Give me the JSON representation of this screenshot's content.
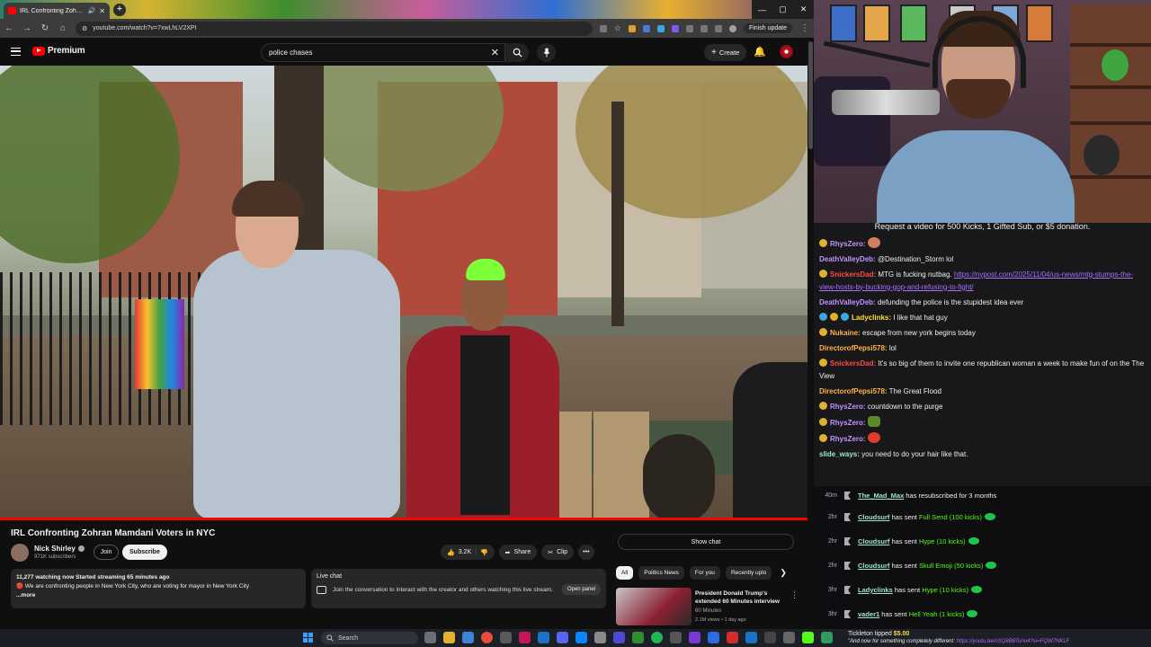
{
  "browser": {
    "tab_title": "IRL Confronting Zohran Ma",
    "url": "youtube.com/watch?v=7xwLhLV2XPI",
    "finish_update": "Finish update"
  },
  "youtube": {
    "logo": "Premium",
    "search_query": "police chases",
    "create_label": "Create",
    "video_title": "IRL Confronting Zohran Mamdani Voters in NYC",
    "channel_name": "Nick Shirley",
    "subscribers": "971K subscribers",
    "join_label": "Join",
    "subscribe_label": "Subscribe",
    "likes": "3.2K",
    "share_label": "Share",
    "clip_label": "Clip",
    "show_chat": "Show chat",
    "description": {
      "stats": "11,277 watching now  Started streaming 65 minutes ago",
      "text": "🔴 We are confronting people in New York City, who are voting for mayor in New York City",
      "more": "...more"
    },
    "live_chat": {
      "title": "Live chat",
      "text": "Join the conversation to interact with the creator and others watching this live stream.",
      "open_panel": "Open panel"
    },
    "chips": [
      "All",
      "Politics News",
      "For you",
      "Recently uplo"
    ],
    "recommendation": {
      "title": "President Donald Trump's extended 60 Minutes interview",
      "channel": "60 Minutes",
      "meta": "2.1M views • 1 day ago"
    }
  },
  "chat": {
    "goal_text": "Request a video for 500 Kicks, 1 Gifted Sub, or $5 donation.",
    "messages": [
      {
        "user": "RhysZero:",
        "color": "#bf94ff",
        "text": ""
      },
      {
        "user": "DeathValleyDeb:",
        "color": "#bf94ff",
        "text": "@Destination_Storm lol"
      },
      {
        "user": "SnickersDad:",
        "color": "#ff4a4a",
        "text": "MTG is fucking nutbag.",
        "link": "https://nypost.com/2025/11/04/us-news/mtg-stumps-the-view-hosts-by-bucking-gop-and-refusing-to-fight/"
      },
      {
        "user": "DeathValleyDeb:",
        "color": "#bf94ff",
        "text": "defunding the police is the stupidest idea ever"
      },
      {
        "user": "Ladyclinks:",
        "color": "#ffde3a",
        "text": "I like that hat guy"
      },
      {
        "user": "Nukaine:",
        "color": "#ffb347",
        "text": "escape from new york begins today"
      },
      {
        "user": "DirectorofPepsi578:",
        "color": "#ffb347",
        "text": "lol"
      },
      {
        "user": "SnickersDad:",
        "color": "#ff4a4a",
        "text": "It's so big of them to invite one republican woman a week to make fun of on the The View"
      },
      {
        "user": "DirectorofPepsi578:",
        "color": "#ffb347",
        "text": "The Great Flood"
      },
      {
        "user": "RhysZero:",
        "color": "#bf94ff",
        "text": "countdown to the purge"
      },
      {
        "user": "RhysZero:",
        "color": "#bf94ff",
        "text": ""
      },
      {
        "user": "RhysZero:",
        "color": "#bf94ff",
        "text": ""
      },
      {
        "user": "slide_ways:",
        "color": "#a0e4c7",
        "text": "you need to do your hair like that."
      }
    ],
    "events": [
      {
        "time": "40m",
        "user": "The_Mad_Max",
        "text": "has resubscribed for 3 months",
        "gift": ""
      },
      {
        "time": "2hr",
        "user": "Cloudsurf",
        "text": "has sent",
        "gift": "Full Send (100 kicks)"
      },
      {
        "time": "2hr",
        "user": "Cloudsurf",
        "text": "has sent",
        "gift": "Hype (10 kicks)"
      },
      {
        "time": "2hr",
        "user": "Cloudsurf",
        "text": "has sent",
        "gift": "Skull Emoji (50 kicks)"
      },
      {
        "time": "3hr",
        "user": "Ladyclinks",
        "text": "has sent",
        "gift": "Hype (10 kicks)"
      },
      {
        "time": "3hr",
        "user": "vader1",
        "text": "has sent",
        "gift": "Hell Yeah (1 kicks)"
      }
    ],
    "tip": {
      "user": "Tickleton tipped",
      "amount": "$5.00",
      "message": "\"And now for something completely different:",
      "link": "https://youtu.be/nSQ8B8Tuno4?si=FQW7NKLF"
    }
  },
  "taskbar": {
    "search_placeholder": "Search"
  }
}
